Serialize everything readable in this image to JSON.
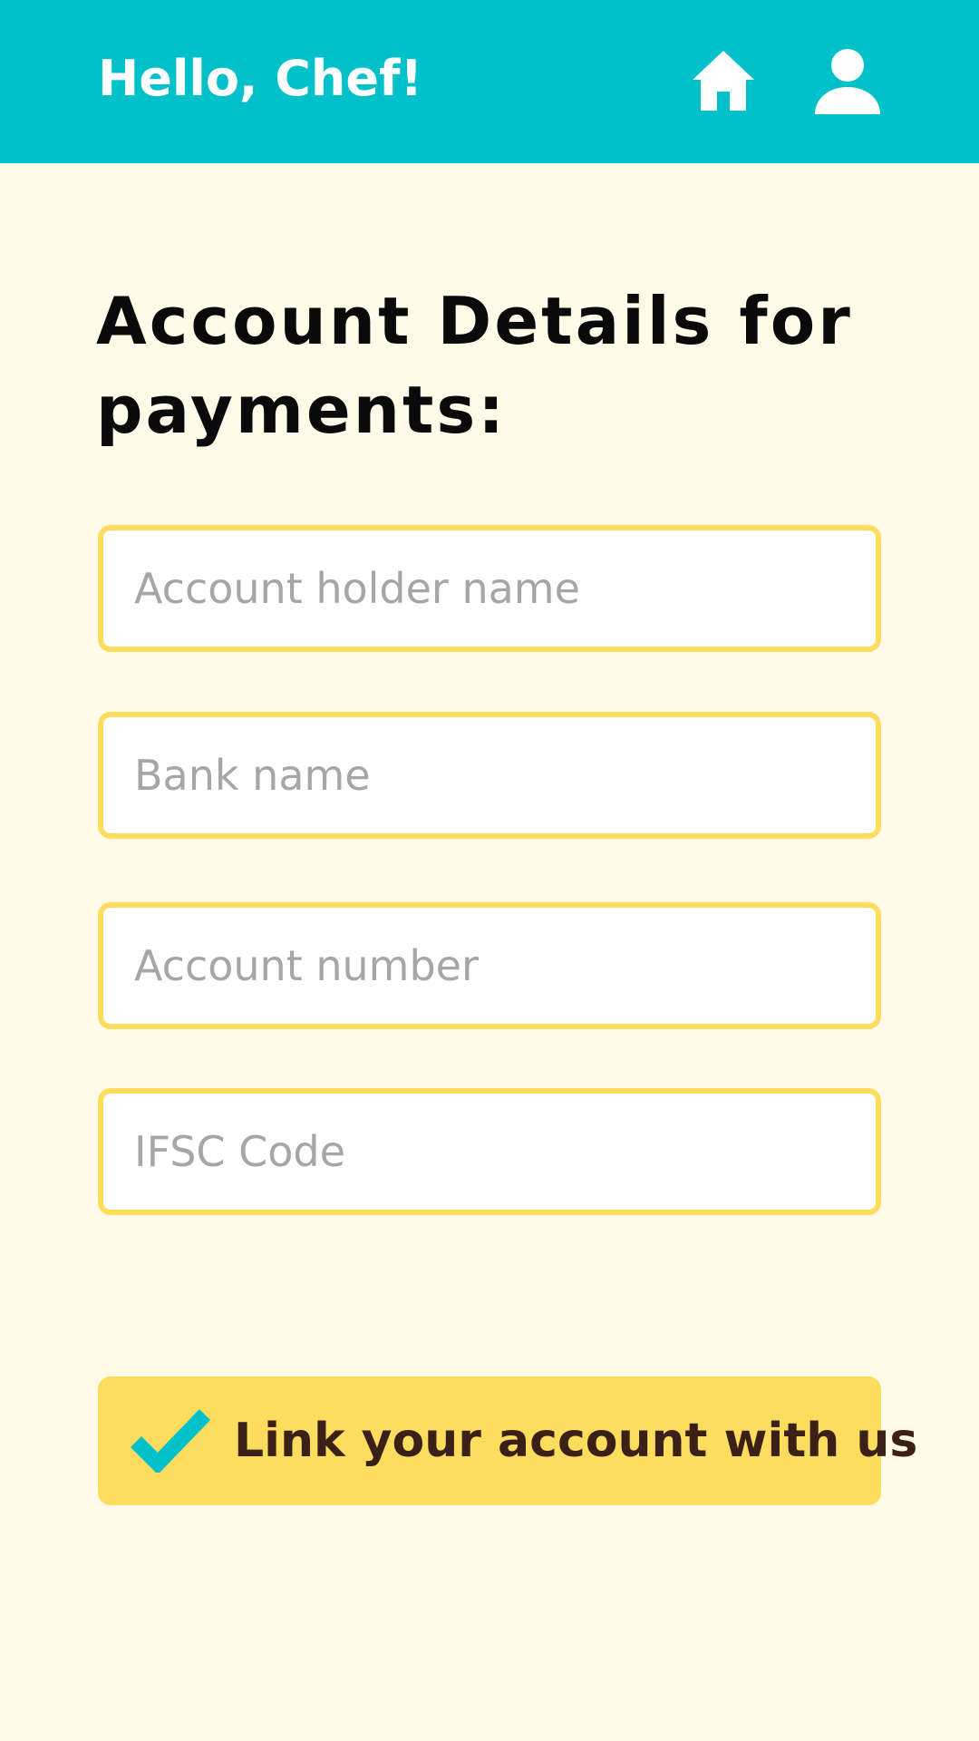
{
  "header": {
    "greeting": "Hello, Chef!",
    "icons": [
      "home-icon",
      "user-icon"
    ]
  },
  "page": {
    "title": "Account Details for payments:"
  },
  "form": {
    "fields": [
      {
        "placeholder": "Account holder name",
        "value": ""
      },
      {
        "placeholder": "Bank name",
        "value": ""
      },
      {
        "placeholder": "Account number",
        "value": ""
      },
      {
        "placeholder": "IFSC Code",
        "value": ""
      }
    ],
    "submit_label": "Link your account with us",
    "submit_icon": "checkmark-icon"
  },
  "colors": {
    "header_background": "#00C1CA",
    "page_background": "#FFFBE8",
    "field_border": "#FCDD5D",
    "button_background": "#FCDD5D",
    "check_mark": "#00C1CA",
    "button_text": "#3A2016"
  }
}
